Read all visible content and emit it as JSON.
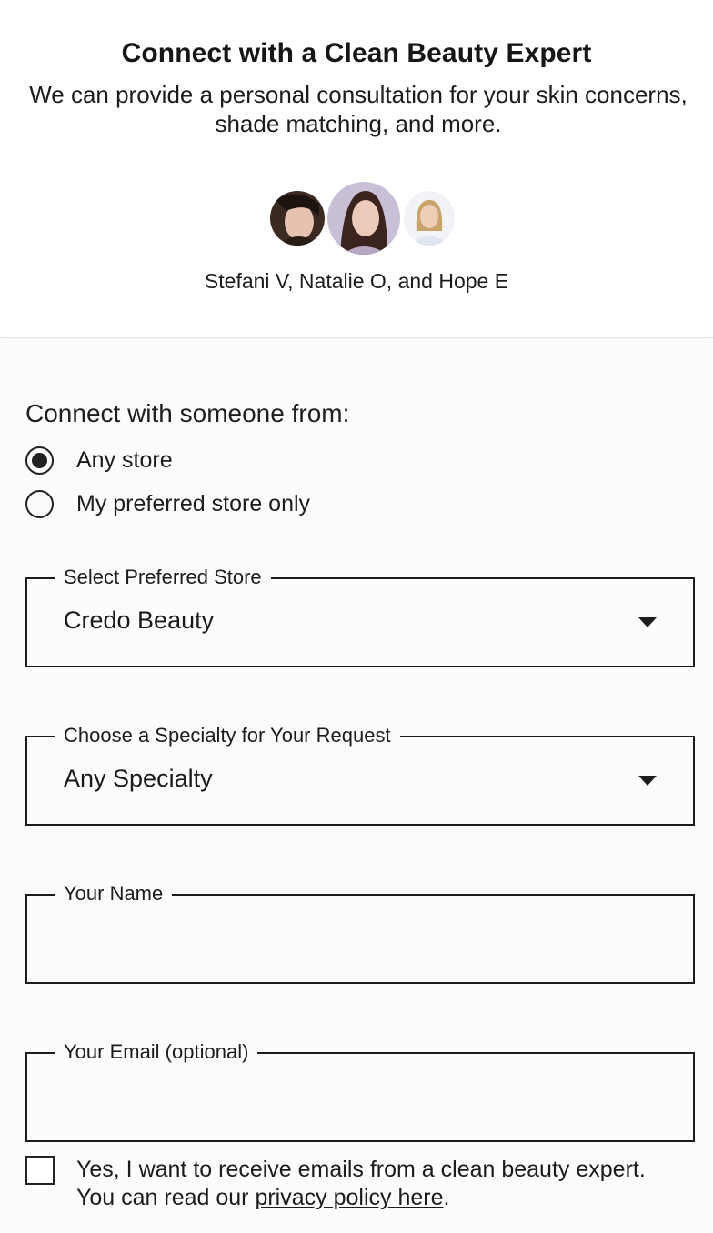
{
  "header": {
    "title": "Connect with a Clean Beauty Expert",
    "subtitle": "We can provide a personal consultation for your skin concerns, shade matching, and more.",
    "experts_text": "Stefani V, Natalie O, and Hope E"
  },
  "form": {
    "connect_label": "Connect with someone from:",
    "radio_options": [
      {
        "label": "Any store",
        "checked": true
      },
      {
        "label": "My preferred store only",
        "checked": false
      }
    ],
    "store_select": {
      "legend": "Select Preferred Store",
      "value": "Credo Beauty"
    },
    "specialty_select": {
      "legend": "Choose a Specialty for Your Request",
      "value": "Any Specialty"
    },
    "name_field": {
      "legend": "Your Name",
      "value": ""
    },
    "email_field": {
      "legend": "Your Email (optional)",
      "value": ""
    },
    "consent": {
      "checked": false,
      "text_line1": "Yes, I want to receive emails from a clean beauty expert.",
      "text_prefix": "You can read our ",
      "link_text": "privacy policy here",
      "text_suffix": "."
    }
  }
}
